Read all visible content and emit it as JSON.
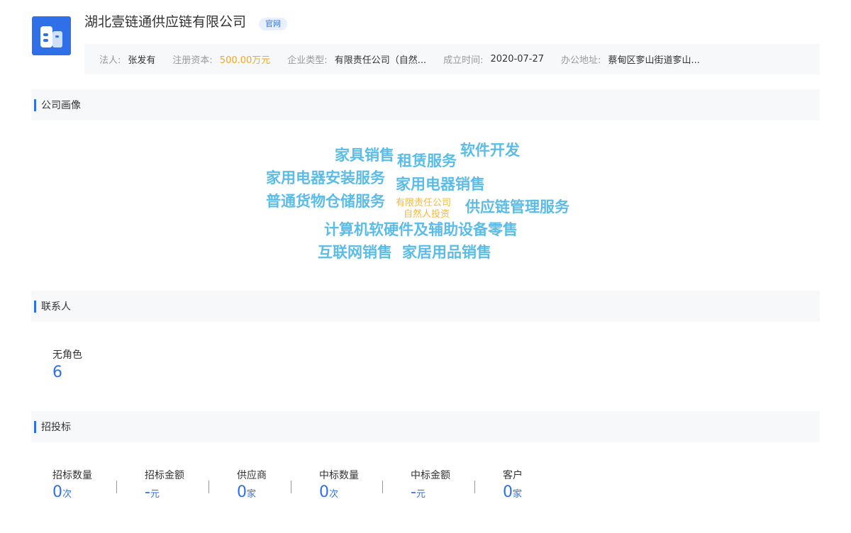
{
  "company": {
    "name": "湖北壹链通供应链有限公司",
    "official_tag": "官网"
  },
  "info": [
    {
      "label": "法人:",
      "value": "张发有"
    },
    {
      "label": "注册资本:",
      "value": "500.00万元"
    },
    {
      "label": "企业类型:",
      "value": "有限责任公司（自然..."
    },
    {
      "label": "成立时间:",
      "value": "2020-07-27"
    },
    {
      "label": "办公地址:",
      "value": "蔡甸区奓山街道奓山..."
    }
  ],
  "sections": {
    "portrait": "公司画像",
    "contacts": "联系人",
    "bidding": "招投标"
  },
  "word_cloud": [
    "家具销售",
    "租赁服务",
    "软件开发",
    "家用电器安装服务",
    "家用电器销售",
    "普通货物仓储服务",
    "有限责任公司",
    "自然人投资",
    "供应链管理服务",
    "计算机软硬件及辅助设备零售",
    "互联网销售",
    "家居用品销售"
  ],
  "contacts": {
    "label": "无角色",
    "count": "6"
  },
  "bidding": [
    {
      "label": "招标数量",
      "value": "0",
      "unit": "次"
    },
    {
      "label": "招标金额",
      "value": "-",
      "unit": "元"
    },
    {
      "label": "供应商",
      "value": "0",
      "unit": "家"
    },
    {
      "label": "中标数量",
      "value": "0",
      "unit": "次"
    },
    {
      "label": "中标金额",
      "value": "-",
      "unit": "元"
    },
    {
      "label": "客户",
      "value": "0",
      "unit": "家"
    }
  ],
  "colors": {
    "accent": "#2f6fe8",
    "cloud_word": "#5bbce8",
    "cloud_small": "#f5b83a",
    "capital": "#f5a623"
  }
}
